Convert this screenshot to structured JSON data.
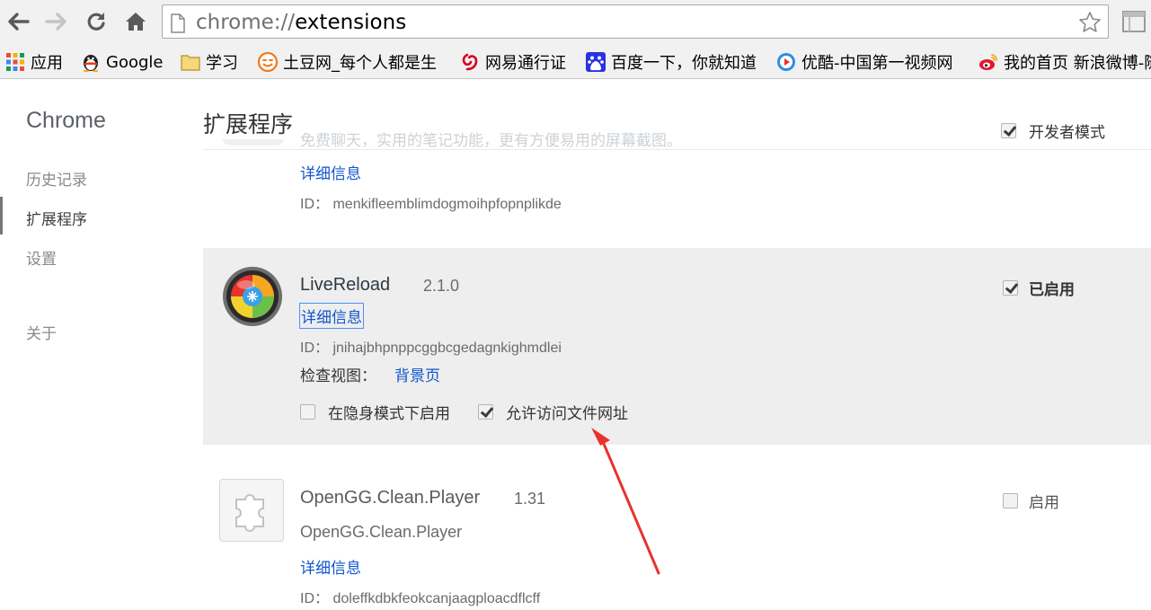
{
  "browser": {
    "url_scheme": "chrome://",
    "url_path": "extensions",
    "nav": [
      "back-icon",
      "forward-icon",
      "reload-icon",
      "home-icon"
    ],
    "bookmarks": [
      {
        "icon": "apps-icon",
        "label": "应用"
      },
      {
        "icon": "qq-icon",
        "label": "Google"
      },
      {
        "icon": "folder-icon",
        "label": "学习"
      },
      {
        "icon": "tudou-icon",
        "label": "土豆网_每个人都是生"
      },
      {
        "icon": "netease-icon",
        "label": "网易通行证"
      },
      {
        "icon": "baidu-icon",
        "label": "百度一下，你就知道"
      },
      {
        "icon": "youku-icon",
        "label": "优酷-中国第一视频网"
      },
      {
        "icon": "weibo-icon",
        "label": "我的首页 新浪微博-随"
      }
    ]
  },
  "sidebar": {
    "title": "Chrome",
    "items": [
      {
        "label": "历史记录",
        "selected": false
      },
      {
        "label": "扩展程序",
        "selected": true
      },
      {
        "label": "设置",
        "selected": false
      },
      {
        "label": "关于",
        "selected": false
      }
    ]
  },
  "header": {
    "title": "扩展程序",
    "dev_mode_label": "开发者模式",
    "dev_mode_checked": true
  },
  "extensions": [
    {
      "name": "",
      "description": "免费聊天，实用的笔记功能，更有方便易用的屏幕截图。",
      "details_label": "详细信息",
      "id_label": "ID：",
      "id": "menkifleemblimdogmoihpfopnplikde"
    },
    {
      "name": "LiveReload",
      "version": "2.1.0",
      "details_label": "详细信息",
      "id_label": "ID：",
      "id": "jnihajbhpnppcggbcgedagnkighmdlei",
      "inspect_label": "检查视图：",
      "inspect_link": "背景页",
      "enabled_label": "已启用",
      "enabled": true,
      "incognito_label": "在隐身模式下启用",
      "incognito": false,
      "file_access_label": "允许访问文件网址",
      "file_access": true
    },
    {
      "name": "OpenGG.Clean.Player",
      "version": "1.31",
      "description": "OpenGG.Clean.Player",
      "details_label": "详细信息",
      "id_label": "ID：",
      "id": "doleffkdbkfeokcanjaagploacdflcff",
      "enabled_label": "启用",
      "enabled": false
    }
  ],
  "colors": {
    "link": "#1155cc",
    "annotation_arrow": "#e8322d",
    "card_highlight": "#eeeeee"
  }
}
